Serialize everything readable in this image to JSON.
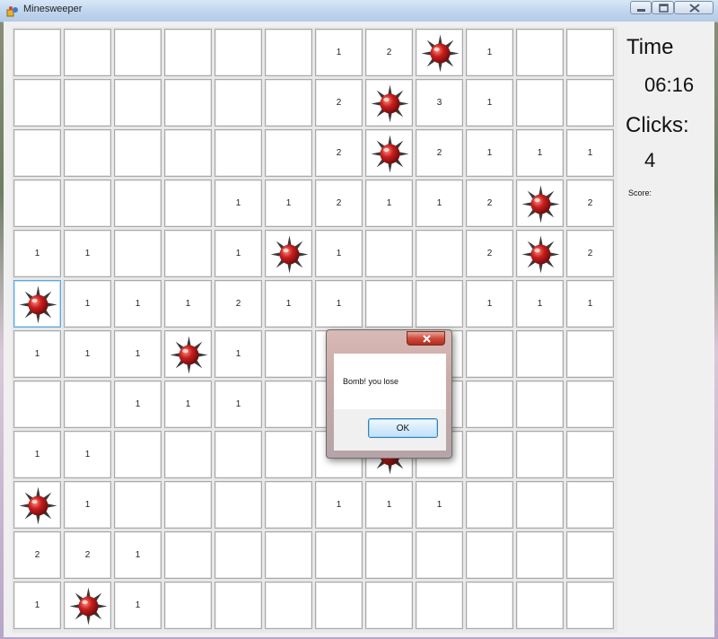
{
  "window": {
    "title": "Minesweeper"
  },
  "sidebar": {
    "time_label": "Time",
    "time_value": "06:16",
    "clicks_label": "Clicks:",
    "clicks_value": "4",
    "score_label": "Score:"
  },
  "dialog": {
    "message": "Bomb! you lose",
    "ok_label": "OK"
  },
  "board": {
    "rows": 12,
    "cols": 12,
    "focused_cell": [
      5,
      0
    ],
    "grid": [
      [
        "",
        "",
        "",
        "",
        "",
        "",
        "1",
        "2",
        "M",
        "1",
        "",
        ""
      ],
      [
        "",
        "",
        "",
        "",
        "",
        "",
        "2",
        "M",
        "3",
        "1",
        "",
        ""
      ],
      [
        "",
        "",
        "",
        "",
        "",
        "",
        "2",
        "M",
        "2",
        "1",
        "1",
        "1"
      ],
      [
        "",
        "",
        "",
        "",
        "1",
        "1",
        "2",
        "1",
        "1",
        "2",
        "M",
        "2"
      ],
      [
        "1",
        "1",
        "",
        "",
        "1",
        "M",
        "1",
        "",
        "",
        "2",
        "M",
        "2"
      ],
      [
        "M",
        "1",
        "1",
        "1",
        "2",
        "1",
        "1",
        "",
        "",
        "1",
        "1",
        "1"
      ],
      [
        "1",
        "1",
        "1",
        "M",
        "1",
        "",
        "",
        "",
        "",
        "",
        "",
        ""
      ],
      [
        "",
        "",
        "1",
        "1",
        "1",
        "",
        "",
        "",
        "",
        "",
        "",
        ""
      ],
      [
        "1",
        "1",
        "",
        "",
        "",
        "",
        "",
        "M",
        "",
        "",
        "",
        ""
      ],
      [
        "M",
        "1",
        "",
        "",
        "",
        "",
        "1",
        "1",
        "1",
        "",
        "",
        ""
      ],
      [
        "2",
        "2",
        "1",
        "",
        "",
        "",
        "",
        "",
        "",
        "",
        "",
        ""
      ],
      [
        "1",
        "M",
        "1",
        "",
        "",
        "",
        "",
        "",
        "",
        "",
        "",
        ""
      ]
    ]
  },
  "colors": {
    "mine": "#c81e1e",
    "spike": "#3a3a3a"
  },
  "icons": {
    "mine": "mine-icon",
    "app": "app-icon",
    "close": "close-icon"
  }
}
